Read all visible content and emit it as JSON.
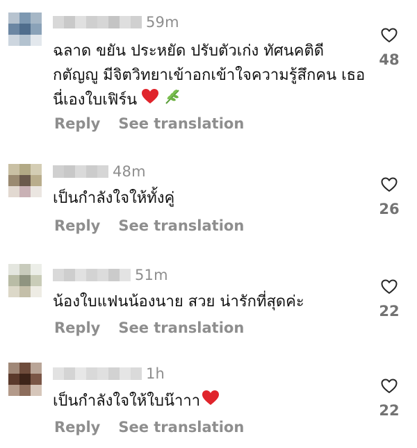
{
  "comments": [
    {
      "time": "59m",
      "text": "ฉลาด ขยัน ประหยัด ปรับตัวเก่ง ทัศนคติดี กตัญญู มีจิตวิทยาเข้าอกเข้าใจความรู้สึกคน เธอนี่เองใบเฟิร์น",
      "emoji": [
        "red-heart",
        "herb"
      ],
      "reply_label": "Reply",
      "translate_label": "See translation",
      "likes": "48"
    },
    {
      "time": "48m",
      "text": "เป็นกำลังใจให้ทั้งคู่",
      "emoji": [],
      "reply_label": "Reply",
      "translate_label": "See translation",
      "likes": "26"
    },
    {
      "time": "51m",
      "text": "น้องใบแฟนน้องนาย สวย น่ารักที่สุดค่ะ",
      "emoji": [],
      "reply_label": "Reply",
      "translate_label": "See translation",
      "likes": "22"
    },
    {
      "time": "1h",
      "text": "เป็นกำลังใจให้ใบน๊าาา",
      "emoji": [
        "red-heart"
      ],
      "reply_label": "Reply",
      "translate_label": "See translation",
      "likes": "22"
    }
  ],
  "colors": {
    "muted_text": "#8e8e8e",
    "heart_emoji": "#e0242b",
    "like_outline": "#262626"
  }
}
